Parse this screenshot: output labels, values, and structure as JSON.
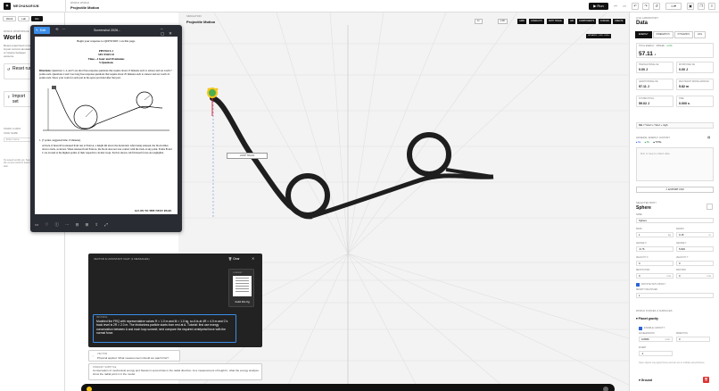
{
  "app": {
    "brand": "MECHANARIUM"
  },
  "topbar": {
    "project_kicker": "WORLD WORLD",
    "project_name": "Projectile Motion",
    "run_label": "Run",
    "icons": [
      "rewind-icon",
      "step-icon",
      "undo-icon",
      "redo-icon",
      "history-icon",
      "layout-icon",
      "save-icon",
      "copy-icon",
      "menu-icon"
    ]
  },
  "left_panel": {
    "tabs": [
      "World",
      "Lab",
      "Info"
    ],
    "kicker": "WORLD WORKSPACE",
    "title": "World",
    "description": "Reset experiment runs, import current simulation, or restore between versions.",
    "reset": {
      "label": "Reset run",
      "icon": "reset-icon"
    },
    "import": {
      "label": "Import set",
      "icon": "import-icon"
    },
    "saved_kicker": "SAVED LOADS",
    "saved_sub": "SAVE NAME",
    "save_placeholder": "Enter name",
    "note": "No saved worlds yet. Save the current world to load it later."
  },
  "viewport": {
    "kicker": "SIMULATION",
    "name": "Projectile Motion",
    "controls": [
      "1x",
      "2.00",
      "GRID",
      "OVERLAYS",
      "PATH TRACE",
      "AIR",
      "COMPONENTS",
      "FORCES",
      "CREATE"
    ],
    "status": "UPDATED · 0.00 · 0.00 s",
    "track_label": "LOOP TRACK"
  },
  "screenshot": {
    "edit_label": "Edit",
    "title": "Screenshot 2026...",
    "paper": {
      "top_line": "Begin your response to QUESTION 1 on this page.",
      "heading": [
        "PHYSICS 1",
        "SECTION II",
        "Time—1 hour and 30 minutes",
        "5 Questions"
      ],
      "directions_label": "Directions:",
      "directions": "Questions 1, 4, and 5 are short free-response questions that require about 13 minutes each to answer and are worth 7 points each. Questions 2 and 3 are long free-response questions that require about 25 minutes each to answer and are worth 12 points each. Show your work for each part in the space provided after that part.",
      "q1_head": "1. (7 points, suggested time 13 minutes)",
      "q1_text": "A block of mass M is released from rest at Point A, a height 4R above the horizontal. After being released, the block slides down a track, as shown. When released from Point A, the block does not lose contact with the track at any point. Points B and C are located at the highest points of their respective circular loops. Each is shown. All frictional forces are negligible.",
      "next": "GO ON TO THE NEXT PAGE."
    }
  },
  "dialog": {
    "title": "VECTOR AI ASSISTANT CHAT (1 MESSAGES)",
    "clear_label": "Clear",
    "card_kicker": "CONTEXT",
    "card_label": "build this fig.",
    "msg_kicker": "VECTOR AI",
    "message": "Modeled the FRQ with representative values R = 1.0 m and M = 1.0 kg, so A is at 4R = 4.0 m and C's track level is 2R = 2.0 m. The frictionless particle starts from rest at A. Tutorial: first use energy conservation between A and each loop summit; next compare the required centripetal force with the normal force."
  },
  "cards": {
    "c1_kicker": "VECTOR",
    "c1_text": "Physical applied. What measurement should we watch first?",
    "c2_kicker": "PRIMARY SUBTITLE",
    "c2_text": "Conservation of mechanical energy and Newton's second law in the radial direction. At a measurement of height h, what the energy analysis show the radial point in it the model."
  },
  "right_panel": {
    "kicker": "LIVE LABORATORY",
    "title": "Data",
    "tabs": [
      "Energy",
      "Kinematics",
      "Dynamics",
      "Log"
    ],
    "total_energy": {
      "label": "TOTAL ENERGY · SPHERE",
      "value": "57.11",
      "unit": "J",
      "badge": "+0.0%"
    },
    "stats": [
      {
        "label": "TRANSLATIONAL KE",
        "value": "0.00 J"
      },
      {
        "label": "ROTATIONAL KE",
        "value": "0.00 J"
      },
      {
        "label": "GRAVITATIONAL PE",
        "value": "57.11 J"
      },
      {
        "label": "MAX HEIGHT ABOVE GROUND",
        "value": "5.82 m"
      },
      {
        "label": "SYSTEM TOTAL",
        "value": "59.02 J"
      },
      {
        "label": "TIME",
        "value": "0.000 s"
      }
    ],
    "equation": "ME = ½mv² + ½Iω² + mgh",
    "history": {
      "label": "GENERAL ENERGY HISTORY",
      "legend": [
        "KE",
        "PE",
        "TOTAL"
      ],
      "placeholder": "Run or step to collect data"
    },
    "export_label": "EXPORT CSV",
    "object": {
      "kicker": "SELECTED BODY",
      "name": "Sphere"
    },
    "fields": [
      {
        "label": "NAME",
        "value": "Sphere",
        "unit": ""
      },
      {
        "label": "MASS",
        "value": "1",
        "unit": "kg"
      },
      {
        "label": "RADIUS",
        "value": "0.15",
        "unit": "m"
      },
      {
        "label": "CENTER X",
        "value": "-6.76",
        "unit": ""
      },
      {
        "label": "CENTER Y",
        "value": "5.820",
        "unit": ""
      },
      {
        "label": "VELOCITY X",
        "value": "0",
        "unit": ""
      },
      {
        "label": "VELOCITY Y",
        "value": "0",
        "unit": ""
      },
      {
        "label": "RESTITUTION",
        "value": "0",
        "unit": "m/s"
      },
      {
        "label": "FRICTION",
        "value": "0",
        "unit": "m/s"
      }
    ],
    "rotate_label": "ROTATE WITH BODY",
    "density_label": "DENSITY MULTIPLIER",
    "density_value": "1",
    "world": {
      "kicker": "WORLD FORCES & SURFACES",
      "gravity": "Planet gravity",
      "enable_label": "ENABLE GRAVITY",
      "g_label": "ACCELERATION",
      "g_value": "9.8066",
      "g_unit": "m/s²",
      "dir_label": "DIRECTION",
      "dir_value": "0",
      "inv_label": "INVERT",
      "inv_value": "-1",
      "note": "Open objects may apply forces and can act on multiple sub-primitives.",
      "ground": "Ground"
    }
  }
}
